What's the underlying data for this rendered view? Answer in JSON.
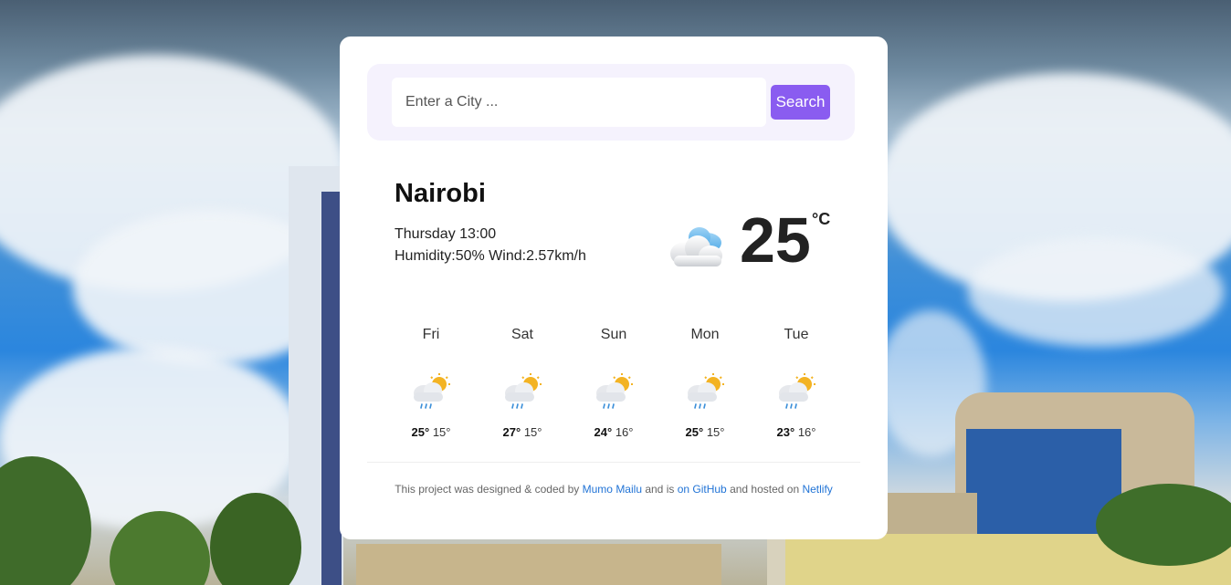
{
  "search": {
    "placeholder": "Enter a City ...",
    "value": "",
    "button_label": "Search"
  },
  "current": {
    "city": "Nairobi",
    "datetime": "Thursday 13:00",
    "humidity_label": "Humidity:",
    "humidity": "50%",
    "wind_label": "Wind:",
    "wind": "2.57km/h",
    "temperature": "25",
    "unit": "°C",
    "icon": "cloud-icon"
  },
  "forecast": [
    {
      "day": "Fri",
      "max": "25°",
      "min": "15°",
      "icon": "rain-sun-icon"
    },
    {
      "day": "Sat",
      "max": "27°",
      "min": "15°",
      "icon": "rain-sun-icon"
    },
    {
      "day": "Sun",
      "max": "24°",
      "min": "16°",
      "icon": "rain-sun-icon"
    },
    {
      "day": "Mon",
      "max": "25°",
      "min": "15°",
      "icon": "rain-sun-icon"
    },
    {
      "day": "Tue",
      "max": "23°",
      "min": "16°",
      "icon": "rain-sun-icon"
    }
  ],
  "footer": {
    "text1": "This project was designed & coded by ",
    "author_link": "Mumo Mailu",
    "text2": " and is ",
    "github_link": "on GitHub",
    "text3": " and hosted on ",
    "netlify_link": "Netlify"
  },
  "colors": {
    "accent": "#8a5cf0",
    "search_panel": "#f5f2fd",
    "link": "#2274d6"
  }
}
